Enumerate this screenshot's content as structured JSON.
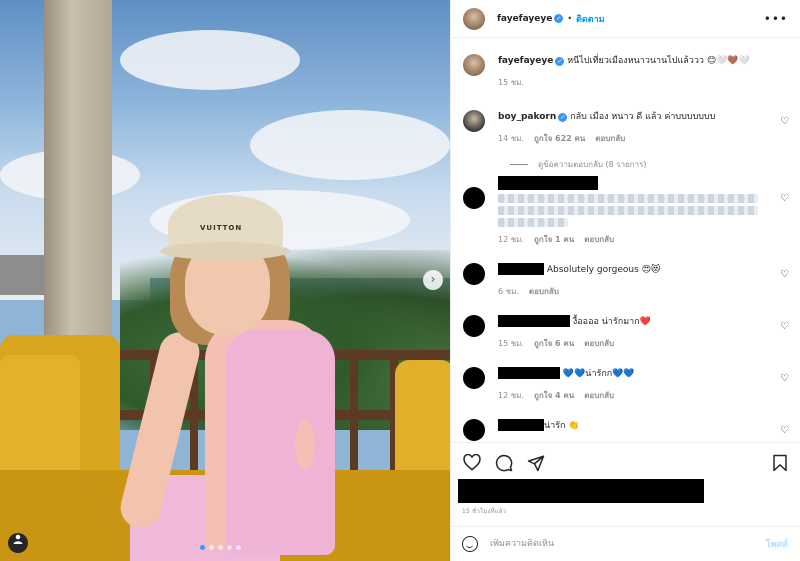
{
  "colors": {
    "accent": "#0095f6",
    "verified": "#3897f0",
    "muted": "#8e8e8e",
    "text": "#262626",
    "post_disabled": "#b2dffc"
  },
  "photo": {
    "hat_text": "VUITTON",
    "carousel": {
      "total_slides": 5,
      "active_slide": 1
    },
    "icons": {
      "next": "chevron-right-icon",
      "tag": "user-tag-icon"
    }
  },
  "header": {
    "username": "fayefayeye",
    "dot": "•",
    "follow": "ติดตาม",
    "more": "•••"
  },
  "caption": {
    "username": "fayefayeye",
    "text": "หนีไปเที่ยวเมืองหนาวนานไปแล้ววว 😊🤍🤎🤍",
    "time": "15 ชม."
  },
  "comments": [
    {
      "username": "boy_pakorn",
      "verified": true,
      "text": "กลับ เมือง หนาว ดี แล้ว ค่าบบบบบบบ",
      "time": "14 ชม.",
      "likes": "ถูกใจ 622 คน",
      "reply": "ตอบกลับ"
    },
    {
      "view_replies": "ดูข้อความตอบกลับ (8 รายการ)",
      "time": "12 ชม.",
      "likes": "ถูกใจ 1 คน",
      "reply": "ตอบกลับ"
    },
    {
      "text": "Absolutely gorgeous 😍😻",
      "time": "6 ชม.",
      "reply": "ตอบกลับ"
    },
    {
      "text": "งื้ออออ น่ารักมาก❤️",
      "time": "15 ชม.",
      "likes": "ถูกใจ 6 คน",
      "reply": "ตอบกลับ"
    },
    {
      "text": "💙💙น่ารักก💙💙",
      "time": "12 ชม.",
      "likes": "ถูกใจ 4 คน",
      "reply": "ตอบกลับ"
    },
    {
      "text": "น่ารัก 👏"
    }
  ],
  "actions": {
    "icons": [
      "heart-icon",
      "comment-icon",
      "share-icon",
      "bookmark-icon"
    ]
  },
  "post_time": "15 ชั่วโมงที่แล้ว",
  "comment_box": {
    "placeholder": "เพิ่มความคิดเห็น",
    "post": "โพสต์"
  }
}
